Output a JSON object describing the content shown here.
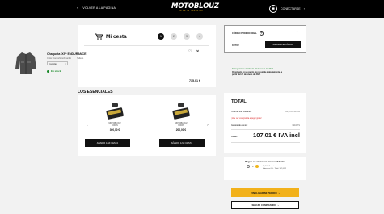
{
  "header": {
    "back_label": "VOLVER A LA PÁGINA",
    "logo_text": "MOTOBLOUZ",
    "logo_tagline": "RIDE IN THE WIND",
    "user_label": "CONECTARSE"
  },
  "cart": {
    "title": "Mi cesta",
    "steps": [
      "1",
      "2",
      "3",
      "4"
    ],
    "product": {
      "name": "Chaqueta IXS* ENDURANCE",
      "color": "Color: Camo/Gris/Amarillo",
      "size": "Talla: L",
      "qty": "Cantidad",
      "stock": "En stock",
      "price": "735,01 €"
    }
  },
  "essentials": {
    "title": "LOS ESENCIALES",
    "items": [
      {
        "name": "MOTOBLOUZ\nKODIN",
        "price": "300,00 €",
        "button": "AÑADIR A MI CESTA"
      },
      {
        "name": "MOTOBLOUZ\nKODIN",
        "price": "200,00 €",
        "button": "AÑADIR A MI CESTA"
      }
    ]
  },
  "promo": {
    "label": "CÓDIGO PROMOCIONAL",
    "help": "?",
    "code": "DUTO2",
    "remove_label": "SUPRIMIR EL CÓDIGO"
  },
  "shipping_note": {
    "line1": "Entrega hasta el sábado 18 de enero de 2025",
    "line2": "O recíbelo en un punto de recogida gratuitamente, a",
    "line3": "partir del 21 de enero de 2025"
  },
  "total": {
    "title": "TOTAL",
    "rows": [
      {
        "k": "Total de los productos",
        "v": "735,01 € IVA incl"
      },
      {
        "k": "Gastos de envío :",
        "v": "GRATIS"
      }
    ],
    "warning": "¡Vale vez una gratuita a pagar gratis!",
    "sum_label": "Total :",
    "sum_value": "107,01 € IVA incl"
  },
  "klarna": {
    "title": "Pague en cómodas mensualidades",
    "opt1": "3",
    "opt2": "4",
    "info1": "35,67 € 3 cuotas a ...",
    "info2": "Intereses 0% · Total: 107,01 €"
  },
  "buttons": {
    "checkout": "FINALIZAR MI PEDIDO",
    "continue": "SEGUIR COMPRANDO"
  },
  "colors": {
    "accent": "#f2b11a",
    "green": "#1a8a2a",
    "dark": "#111111"
  }
}
